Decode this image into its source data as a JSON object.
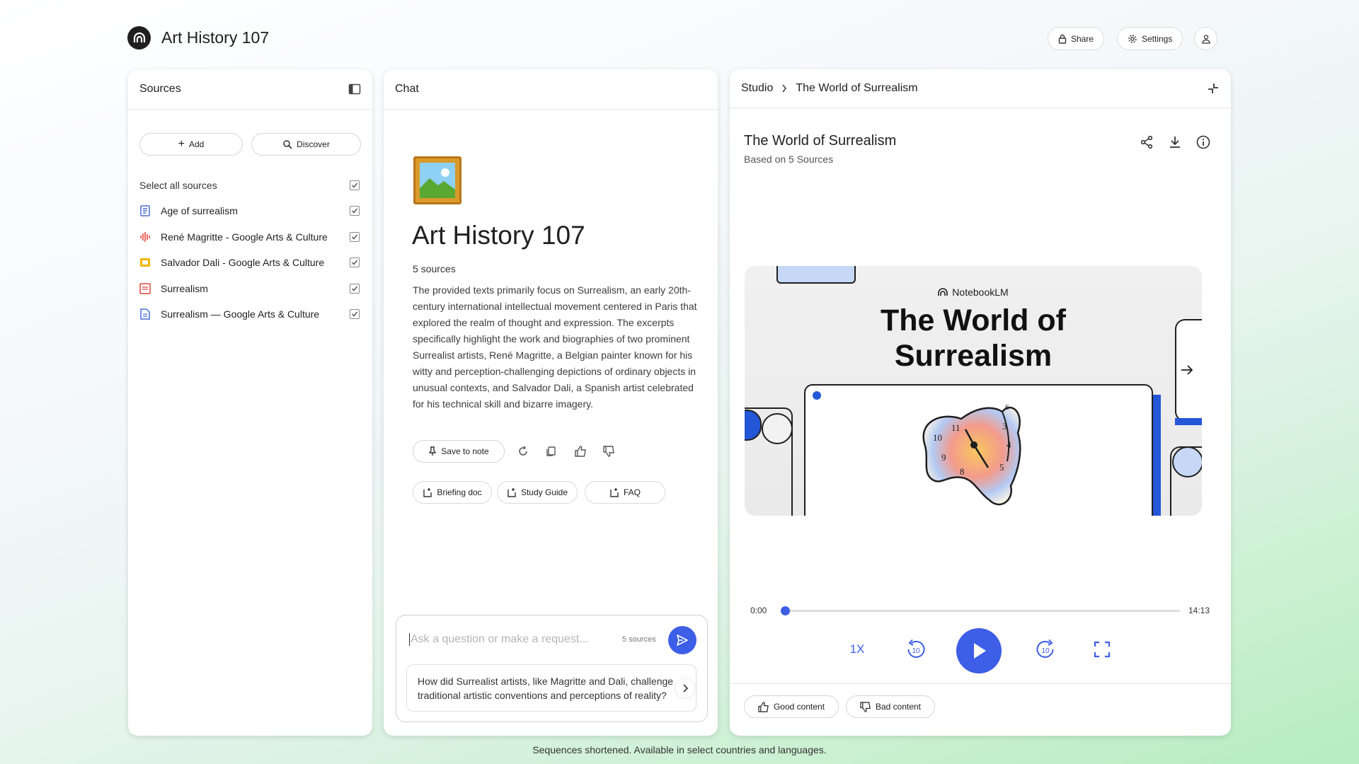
{
  "app": {
    "title": "Art History 107"
  },
  "topbar": {
    "share_label": "Share",
    "settings_label": "Settings"
  },
  "sources": {
    "header": "Sources",
    "add_label": "Add",
    "discover_label": "Discover",
    "select_all_label": "Select all sources",
    "items": [
      {
        "label": "Age of surrealism",
        "icon": "document-icon",
        "color": "#4a6fd6"
      },
      {
        "label": "René Magritte - Google Arts & Culture",
        "icon": "audio-icon",
        "color": "#e4473b"
      },
      {
        "label": "Salvador Dali - Google Arts & Culture",
        "icon": "slides-icon",
        "color": "#f4b400"
      },
      {
        "label": "Surrealism",
        "icon": "pdf-icon",
        "color": "#e4473b"
      },
      {
        "label": "Surrealism — Google Arts & Culture",
        "icon": "doc-icon",
        "color": "#4a6fd6"
      }
    ]
  },
  "chat": {
    "header": "Chat",
    "notebook_title": "Art History 107",
    "source_count": "5 sources",
    "summary": "The provided texts primarily focus on Surrealism, an early 20th-century international intellectual movement centered in Paris that explored the realm of thought and expression. The excerpts specifically highlight the work and biographies of two prominent Surrealist artists, René Magritte, a Belgian painter known for his witty and perception-challenging depictions of ordinary objects in unusual contexts, and Salvador Dali, a Spanish artist celebrated for his technical skill and bizarre imagery.",
    "save_to_note_label": "Save to note",
    "chips": [
      "Briefing doc",
      "Study Guide",
      "FAQ"
    ],
    "input_placeholder": "Ask a question or make a request...",
    "input_sources": "5 sources",
    "suggestion": "How did Surrealist artists, like Magritte and Dali, challenge traditional artistic conventions and perceptions of reality?"
  },
  "studio": {
    "breadcrumb_root": "Studio",
    "breadcrumb_current": "The World of Surrealism",
    "title": "The World of Surrealism",
    "subtitle": "Based on 5 Sources",
    "slide_brand": "NotebookLM",
    "slide_title_line1": "The World of",
    "slide_title_line2": "Surrealism",
    "clock_numbers": [
      "11",
      "10",
      "9",
      "8",
      "3",
      "4",
      "5",
      "6"
    ],
    "time_current": "0:00",
    "time_total": "14:13",
    "progress": 0.0,
    "speed": "1X",
    "skip_seconds": "10",
    "good_label": "Good content",
    "bad_label": "Bad content",
    "accent": "#3d5ee6"
  },
  "footer": {
    "note": "Sequences shortened. Available in select countries and languages."
  }
}
